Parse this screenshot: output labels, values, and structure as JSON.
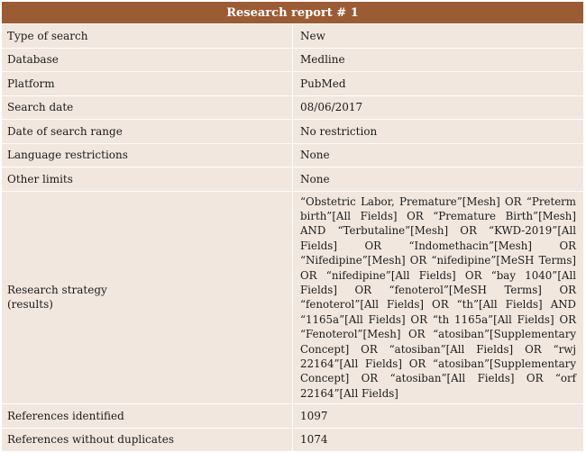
{
  "report": {
    "title": "Research report # 1",
    "rows": [
      {
        "label": "Type of search",
        "value": "New"
      },
      {
        "label": "Database",
        "value": "Medline"
      },
      {
        "label": "Platform",
        "value": "PubMed"
      },
      {
        "label": "Search date",
        "value": "08/06/2017"
      },
      {
        "label": "Date of search range",
        "value": "No restriction"
      },
      {
        "label": "Language restrictions",
        "value": "None"
      },
      {
        "label": "Other limits",
        "value": "None"
      }
    ],
    "strategy": {
      "label_line1": "Research strategy",
      "label_line2": "(results)",
      "value": "“Obstetric Labor, Premature”[Mesh] OR “Preterm birth”[All Fields] OR “Premature Birth”[Mesh] AND “Terbutaline”[Mesh] OR “KWD-2019”[All Fields] OR “Indomethacin”[Mesh] OR “Nifedipine”[Mesh] OR “nifedipine”[MeSH Terms] OR “nifedipine”[All Fields] OR “bay 1040”[All Fields] OR “fenoterol”[MeSH Terms] OR “fenoterol”[All Fields] OR “th”[All Fields] AND “1165a”[All Fields] OR “th 1165a”[All Fields] OR “Fenoterol”[Mesh] OR “atosiban”[Supplementary Concept] OR “atosiban”[All Fields] OR “rwj 22164”[All Fields] OR “atosiban”[Supplementary Concept] OR “atosiban”[All Fields] OR “orf 22164”[All Fields]"
    },
    "references_identified": {
      "label": "References identified",
      "value": "1097"
    },
    "references_without_duplicates": {
      "label": "References without duplicates",
      "value": "1074"
    }
  }
}
